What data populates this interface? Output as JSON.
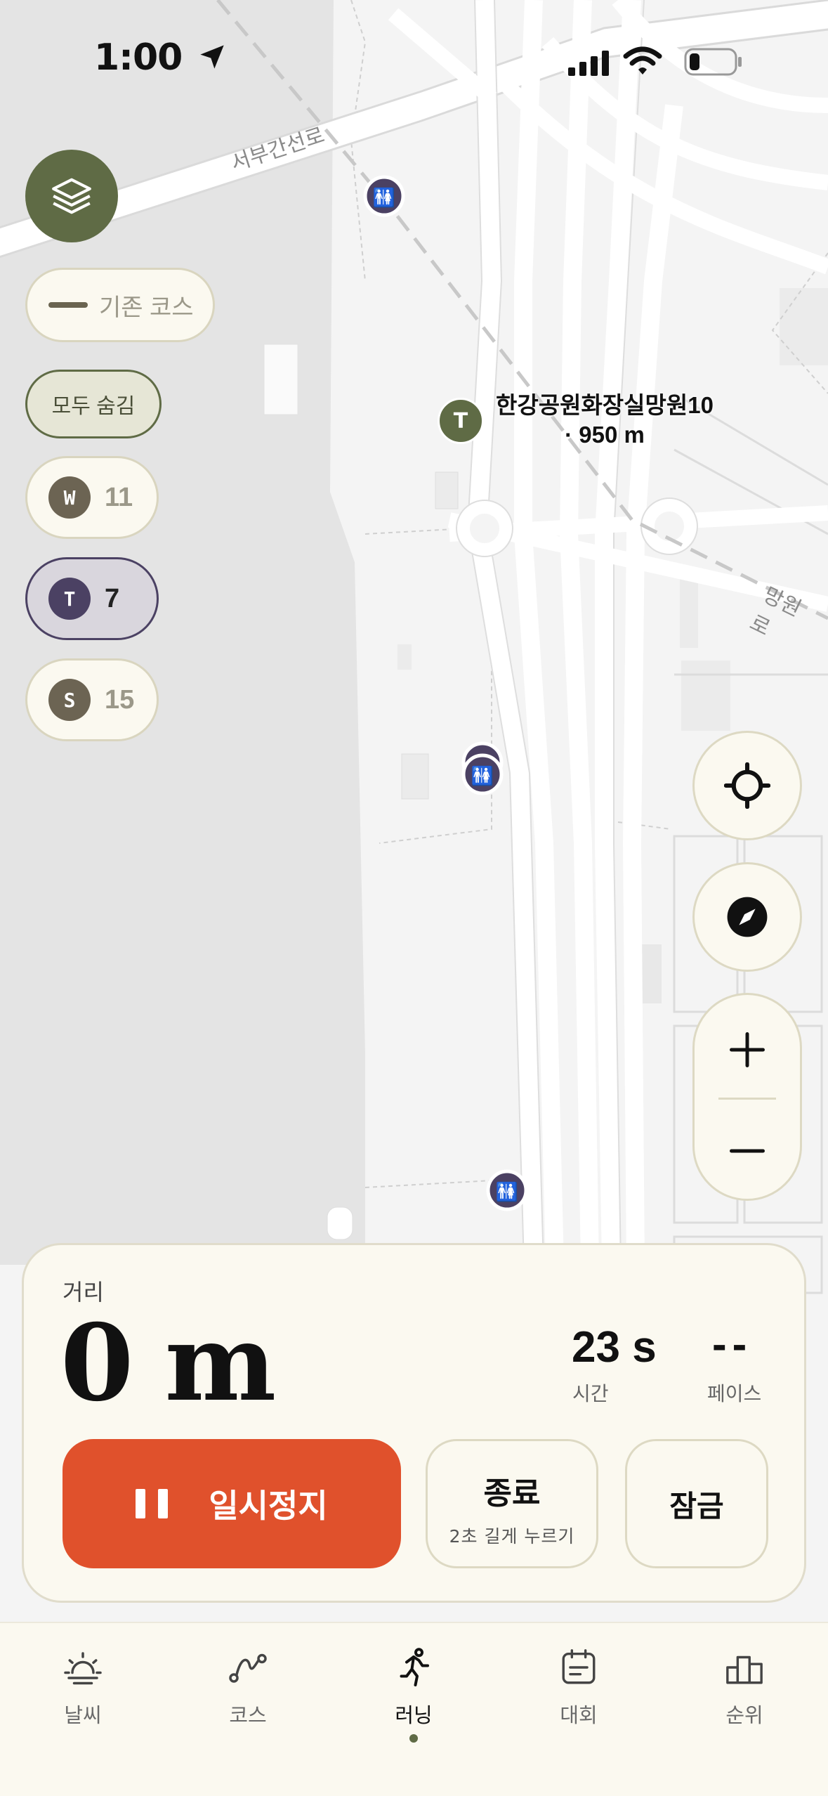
{
  "status_bar": {
    "time": "1:00"
  },
  "map": {
    "road_labels": [
      "서부간선로",
      "망원로"
    ],
    "poi": {
      "badge": "T",
      "name": "한강공원화장실망원10",
      "distance": "· 950 m"
    }
  },
  "legend_chip": {
    "label": "기존 코스"
  },
  "hide_all_chip": {
    "label": "모두 숨김"
  },
  "filters": [
    {
      "badge": "W",
      "count": "11",
      "color": "#6c6453",
      "selected": false
    },
    {
      "badge": "T",
      "count": "7",
      "color": "#4b4163",
      "selected": true
    },
    {
      "badge": "S",
      "count": "15",
      "color": "#6c6453",
      "selected": false
    }
  ],
  "run_panel": {
    "distance_label": "거리",
    "distance_value": "0 m",
    "time_value": "23 s",
    "time_label": "시간",
    "pace_value": "--",
    "pace_label": "페이스",
    "pause_label": "일시정지",
    "end_label": "종료",
    "end_hint": "2초 길게 누르기",
    "lock_label": "잠금"
  },
  "tabs": [
    {
      "label": "날씨",
      "icon": "weather-icon",
      "active": false
    },
    {
      "label": "코스",
      "icon": "course-icon",
      "active": false
    },
    {
      "label": "러닝",
      "icon": "running-icon",
      "active": true
    },
    {
      "label": "대회",
      "icon": "calendar-icon",
      "active": false
    },
    {
      "label": "순위",
      "icon": "ranking-icon",
      "active": false
    }
  ],
  "colors": {
    "accent": "#5f6b45",
    "pause": "#e0512c",
    "panel": "#fbf9f0"
  }
}
